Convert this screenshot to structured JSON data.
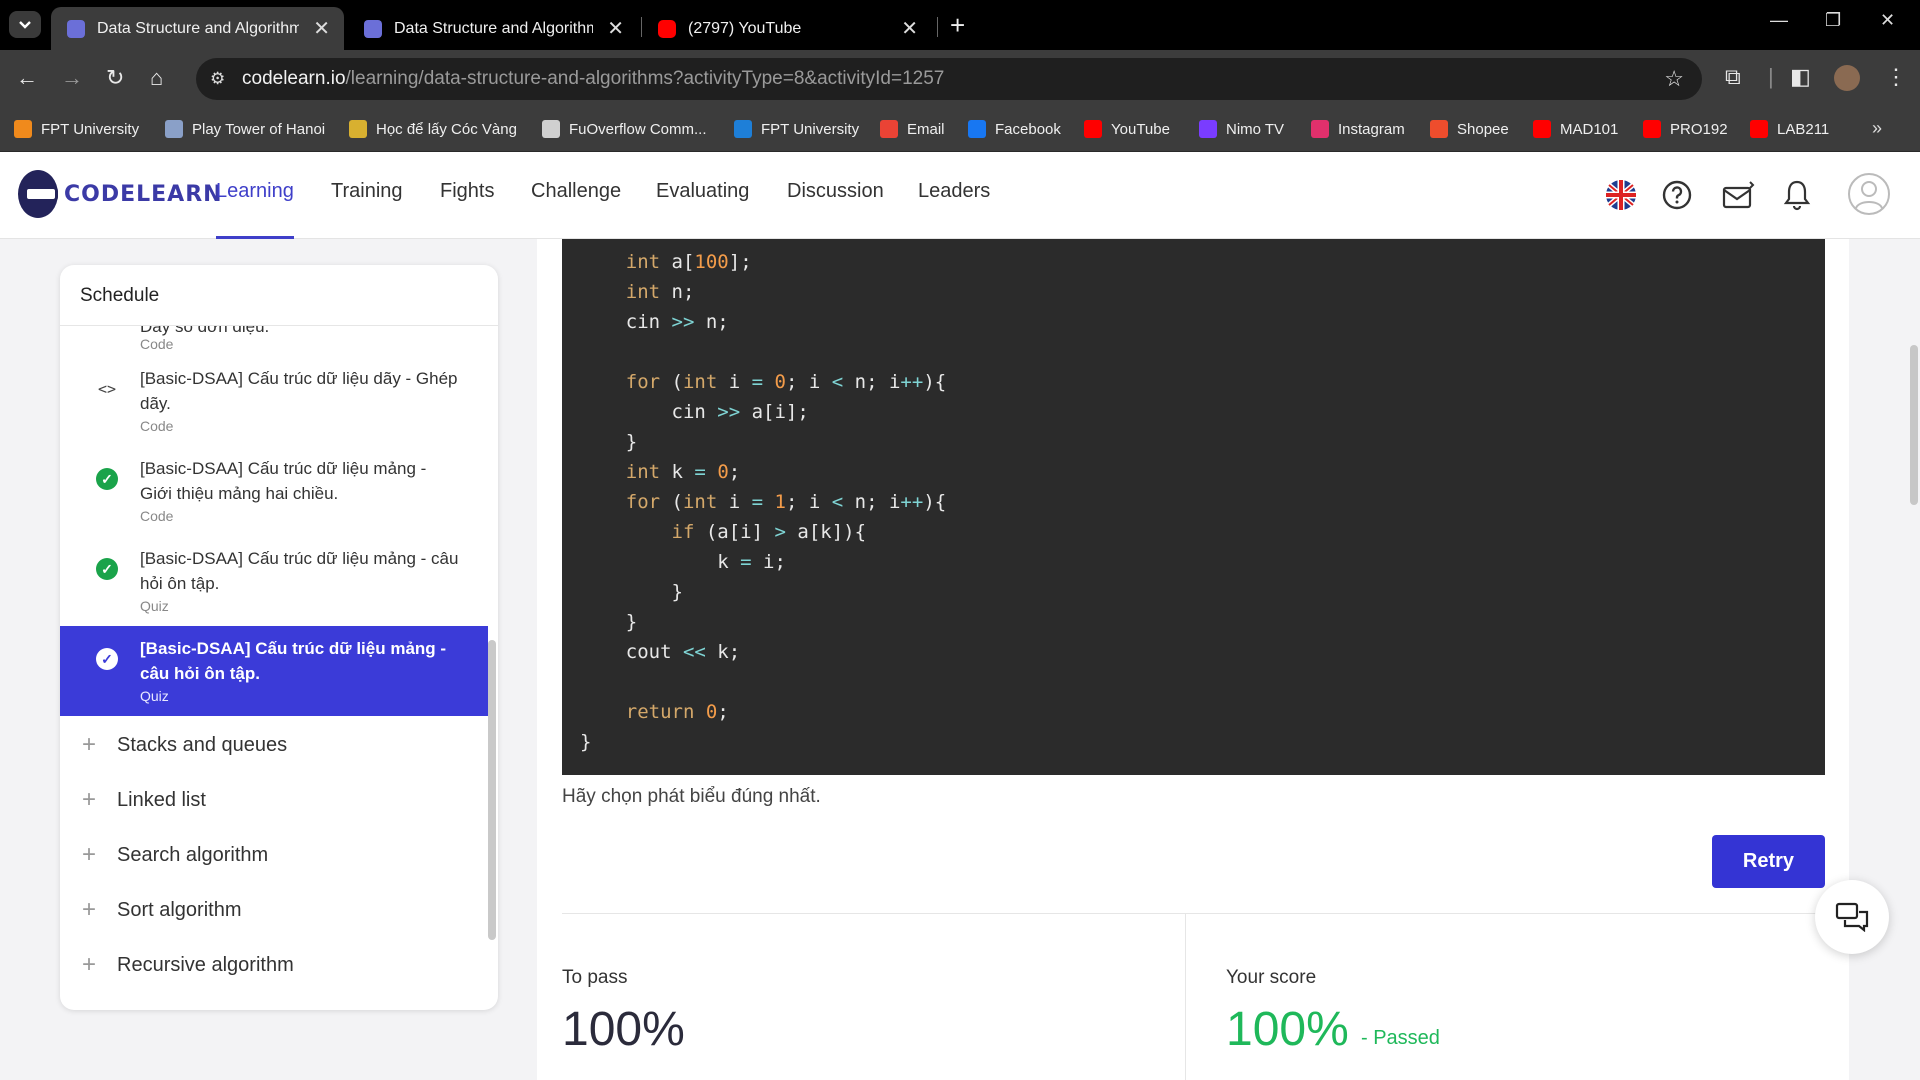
{
  "browser": {
    "tabs": [
      {
        "title": "Data Structure and Algorithms",
        "favicon": "codelearn-icon",
        "active": true
      },
      {
        "title": "Data Structure and Algorithms",
        "favicon": "codelearn-icon",
        "active": false
      },
      {
        "title": "(2797) YouTube",
        "favicon": "youtube-icon",
        "active": false
      }
    ],
    "url_host": "codelearn.io",
    "url_path": "/learning/data-structure-and-algorithms?activityType=8&activityId=1257",
    "bookmarks": [
      {
        "label": "FPT University",
        "icon_color": "#f08a1c"
      },
      {
        "label": "Play Tower of Hanoi",
        "icon_color": "#8aa0c8"
      },
      {
        "label": "Học để lấy Cóc Vàng",
        "icon_color": "#d8b030"
      },
      {
        "label": "FuOverflow Comm...",
        "icon_color": "#d0d0d0"
      },
      {
        "label": "FPT University",
        "icon_color": "#1e7fd8"
      },
      {
        "label": "Email",
        "icon_color": "#ea4335"
      },
      {
        "label": "Facebook",
        "icon_color": "#1877f2"
      },
      {
        "label": "YouTube",
        "icon_color": "#ff0000"
      },
      {
        "label": "Nimo TV",
        "icon_color": "#7a3cff"
      },
      {
        "label": "Instagram",
        "icon_color": "#e1306c"
      },
      {
        "label": "Shopee",
        "icon_color": "#ee4d2d"
      },
      {
        "label": "MAD101",
        "icon_color": "#ff0000"
      },
      {
        "label": "PRO192",
        "icon_color": "#ff0000"
      },
      {
        "label": "LAB211",
        "icon_color": "#ff0000"
      }
    ]
  },
  "site": {
    "logo_text": "CODELEARN",
    "nav": [
      "Learning",
      "Training",
      "Fights",
      "Challenge",
      "Evaluating",
      "Discussion",
      "Leaders"
    ],
    "active_nav": "Learning",
    "accent": "#3f3fc9"
  },
  "sidebar": {
    "title": "Schedule",
    "partial_top_label": "Dãy số đơn điệu.",
    "partial_top_type": "Code",
    "activities": [
      {
        "label": "[Basic-DSAA] Cấu trúc dữ liệu dãy - Ghép dãy.",
        "type": "Code",
        "status": "code-icon"
      },
      {
        "label": "[Basic-DSAA] Cấu trúc dữ liệu mảng - Giới thiệu mảng hai chiều.",
        "type": "Code",
        "status": "completed"
      },
      {
        "label": "[Basic-DSAA] Cấu trúc dữ liệu mảng - câu hỏi ôn tập.",
        "type": "Quiz",
        "status": "completed"
      },
      {
        "label": "[Basic-DSAA] Cấu trúc dữ liệu mảng - câu hỏi ôn tập.",
        "type": "Quiz",
        "status": "current"
      }
    ],
    "sections": [
      "Stacks and queues",
      "Linked list",
      "Search algorithm",
      "Sort algorithm",
      "Recursive algorithm"
    ]
  },
  "code": {
    "lines": [
      "    int a[100];",
      "    int n;",
      "    cin >> n;",
      "",
      "    for (int i = 0; i < n; i++){",
      "        cin >> a[i];",
      "    }",
      "    int k = 0;",
      "    for (int i = 1; i < n; i++){",
      "        if (a[i] > a[k]){",
      "            k = i;",
      "        }",
      "    }",
      "    cout << k;",
      "",
      "    return 0;",
      "}"
    ]
  },
  "quiz": {
    "question": "Hãy chọn phát biểu đúng nhất.",
    "retry_label": "Retry",
    "to_pass_label": "To pass",
    "to_pass_value": "100%",
    "score_label": "Your score",
    "score_value": "100%",
    "score_status": "- Passed",
    "pass_color": "#1fb85a"
  }
}
